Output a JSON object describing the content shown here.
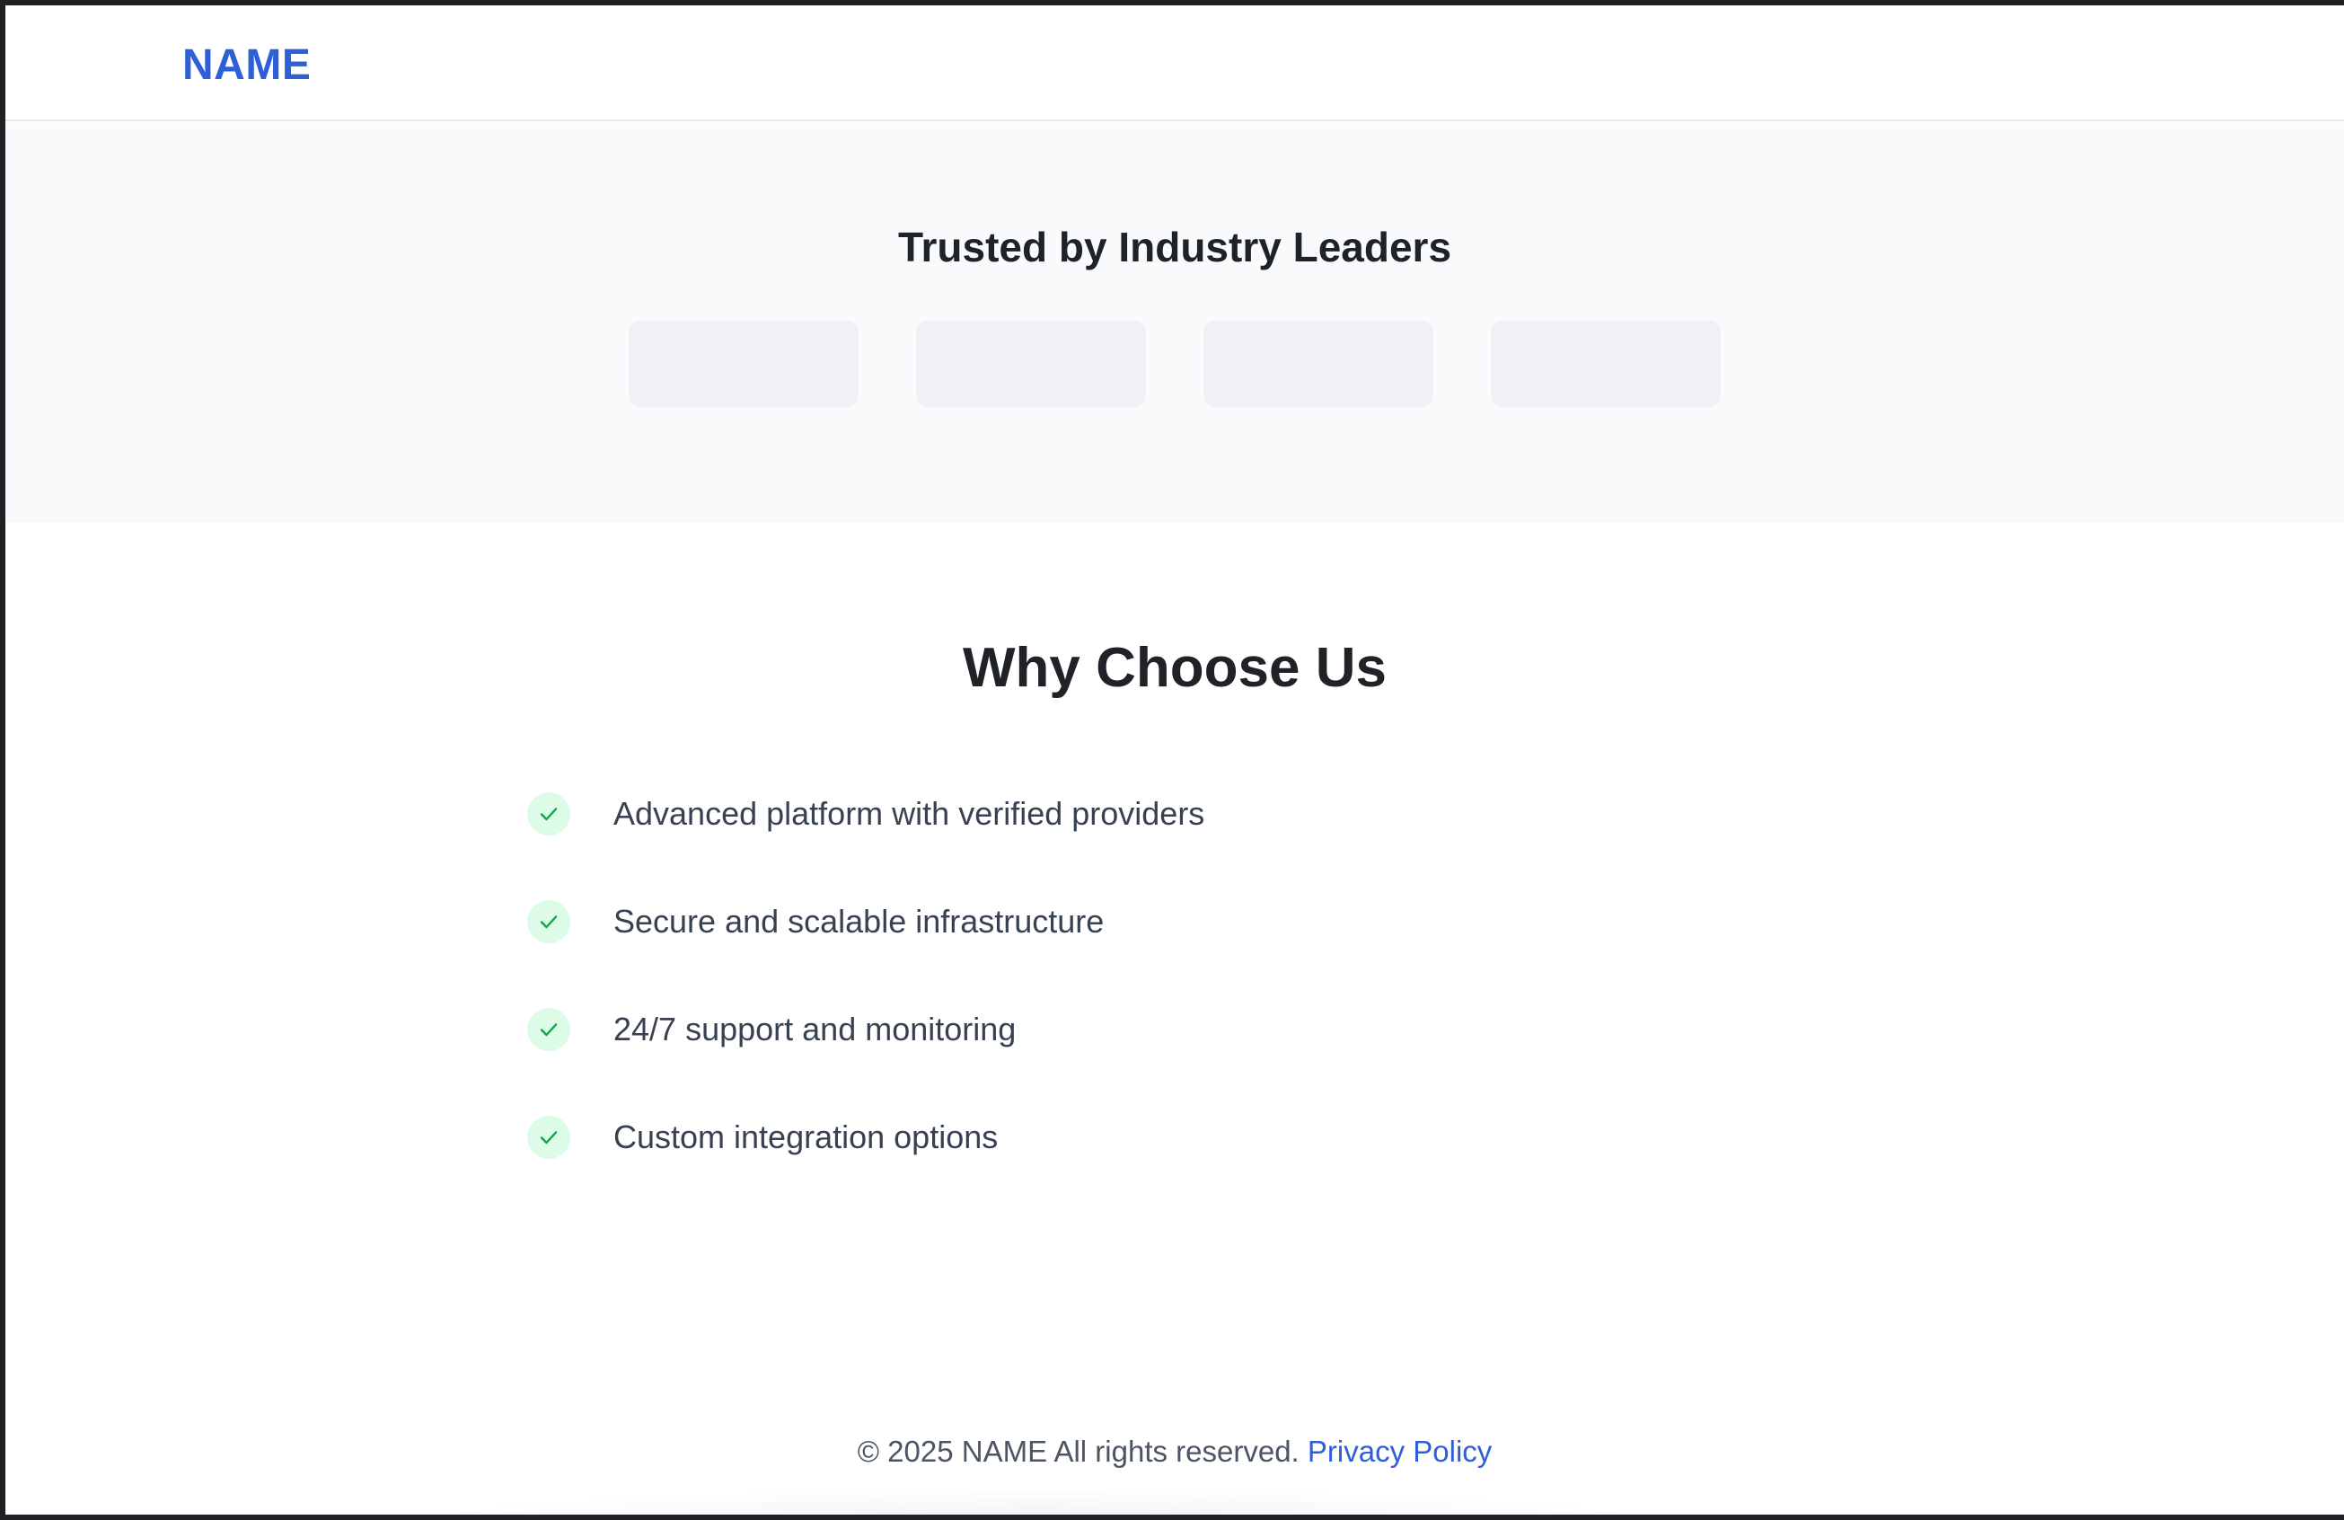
{
  "navbar": {
    "brand": "NAME"
  },
  "trusted": {
    "title": "Trusted by Industry Leaders",
    "logo_count": 4
  },
  "why": {
    "title": "Why Choose Us",
    "features": [
      {
        "icon": "check-icon",
        "label": "Advanced platform with verified providers"
      },
      {
        "icon": "check-icon",
        "label": "Secure and scalable infrastructure"
      },
      {
        "icon": "check-icon",
        "label": "24/7 support and monitoring"
      },
      {
        "icon": "check-icon",
        "label": "Custom integration options"
      }
    ]
  },
  "footer": {
    "copyright": "© 2025 NAME All rights reserved.",
    "privacy_link": "Privacy Policy"
  },
  "colors": {
    "brand": "#2f5fd6",
    "check_bg": "#dcfce7",
    "check_stroke": "#16a34a",
    "logo_placeholder": "#f0f1f4",
    "section_bg": "#f9fafc"
  }
}
